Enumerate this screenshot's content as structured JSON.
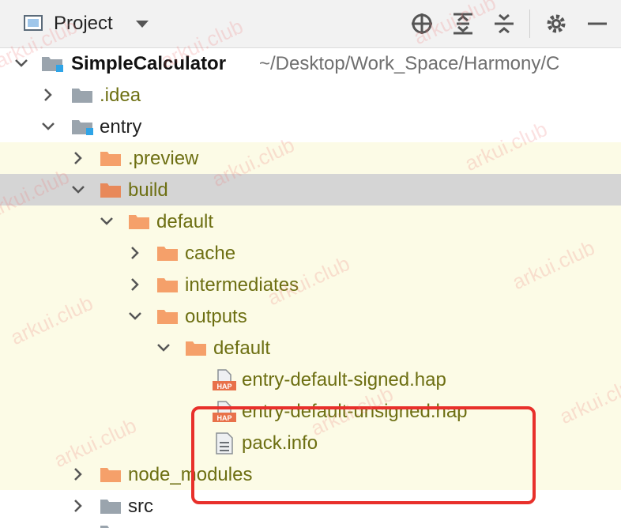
{
  "header": {
    "title": "Project",
    "toolbar": [
      {
        "name": "locate-icon"
      },
      {
        "name": "expand-all-icon"
      },
      {
        "name": "collapse-all-icon"
      },
      {
        "name": "gear-icon"
      },
      {
        "name": "minimize-icon"
      }
    ]
  },
  "tree": {
    "root": {
      "label": "SimpleCalculator",
      "path": "~/Desktop/Work_Space/Harmony/C"
    },
    "idea": ".idea",
    "entry": "entry",
    "preview": ".preview",
    "build": "build",
    "default1": "default",
    "cache": "cache",
    "intermediates": "intermediates",
    "outputs": "outputs",
    "default2": "default",
    "signed": "entry-default-signed.hap",
    "unsigned": "entry-default-unsigned.hap",
    "packinfo": "pack.info",
    "node_modules": "node_modules",
    "src": "src"
  },
  "file_badge": "HAP",
  "watermark": "arkui.club",
  "colors": {
    "folder_orange": "#f5a06a",
    "folder_gray": "#9aa4ad",
    "highlight_yellow": "#fcfbe6",
    "selection_gray": "#d5d5d5",
    "annotation_red": "#e8302b",
    "label_olive": "#6d6f12"
  }
}
